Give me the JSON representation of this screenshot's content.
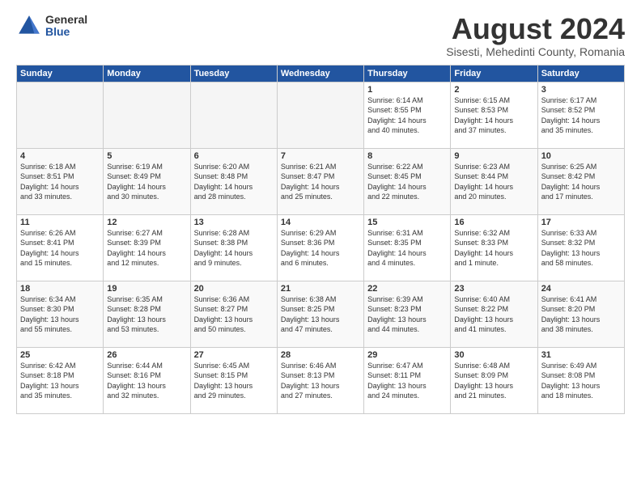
{
  "header": {
    "logo_general": "General",
    "logo_blue": "Blue",
    "main_title": "August 2024",
    "subtitle": "Sisesti, Mehedinti County, Romania"
  },
  "calendar": {
    "headers": [
      "Sunday",
      "Monday",
      "Tuesday",
      "Wednesday",
      "Thursday",
      "Friday",
      "Saturday"
    ],
    "weeks": [
      [
        {
          "day": "",
          "info": ""
        },
        {
          "day": "",
          "info": ""
        },
        {
          "day": "",
          "info": ""
        },
        {
          "day": "",
          "info": ""
        },
        {
          "day": "1",
          "info": "Sunrise: 6:14 AM\nSunset: 8:55 PM\nDaylight: 14 hours\nand 40 minutes."
        },
        {
          "day": "2",
          "info": "Sunrise: 6:15 AM\nSunset: 8:53 PM\nDaylight: 14 hours\nand 37 minutes."
        },
        {
          "day": "3",
          "info": "Sunrise: 6:17 AM\nSunset: 8:52 PM\nDaylight: 14 hours\nand 35 minutes."
        }
      ],
      [
        {
          "day": "4",
          "info": "Sunrise: 6:18 AM\nSunset: 8:51 PM\nDaylight: 14 hours\nand 33 minutes."
        },
        {
          "day": "5",
          "info": "Sunrise: 6:19 AM\nSunset: 8:49 PM\nDaylight: 14 hours\nand 30 minutes."
        },
        {
          "day": "6",
          "info": "Sunrise: 6:20 AM\nSunset: 8:48 PM\nDaylight: 14 hours\nand 28 minutes."
        },
        {
          "day": "7",
          "info": "Sunrise: 6:21 AM\nSunset: 8:47 PM\nDaylight: 14 hours\nand 25 minutes."
        },
        {
          "day": "8",
          "info": "Sunrise: 6:22 AM\nSunset: 8:45 PM\nDaylight: 14 hours\nand 22 minutes."
        },
        {
          "day": "9",
          "info": "Sunrise: 6:23 AM\nSunset: 8:44 PM\nDaylight: 14 hours\nand 20 minutes."
        },
        {
          "day": "10",
          "info": "Sunrise: 6:25 AM\nSunset: 8:42 PM\nDaylight: 14 hours\nand 17 minutes."
        }
      ],
      [
        {
          "day": "11",
          "info": "Sunrise: 6:26 AM\nSunset: 8:41 PM\nDaylight: 14 hours\nand 15 minutes."
        },
        {
          "day": "12",
          "info": "Sunrise: 6:27 AM\nSunset: 8:39 PM\nDaylight: 14 hours\nand 12 minutes."
        },
        {
          "day": "13",
          "info": "Sunrise: 6:28 AM\nSunset: 8:38 PM\nDaylight: 14 hours\nand 9 minutes."
        },
        {
          "day": "14",
          "info": "Sunrise: 6:29 AM\nSunset: 8:36 PM\nDaylight: 14 hours\nand 6 minutes."
        },
        {
          "day": "15",
          "info": "Sunrise: 6:31 AM\nSunset: 8:35 PM\nDaylight: 14 hours\nand 4 minutes."
        },
        {
          "day": "16",
          "info": "Sunrise: 6:32 AM\nSunset: 8:33 PM\nDaylight: 14 hours\nand 1 minute."
        },
        {
          "day": "17",
          "info": "Sunrise: 6:33 AM\nSunset: 8:32 PM\nDaylight: 13 hours\nand 58 minutes."
        }
      ],
      [
        {
          "day": "18",
          "info": "Sunrise: 6:34 AM\nSunset: 8:30 PM\nDaylight: 13 hours\nand 55 minutes."
        },
        {
          "day": "19",
          "info": "Sunrise: 6:35 AM\nSunset: 8:28 PM\nDaylight: 13 hours\nand 53 minutes."
        },
        {
          "day": "20",
          "info": "Sunrise: 6:36 AM\nSunset: 8:27 PM\nDaylight: 13 hours\nand 50 minutes."
        },
        {
          "day": "21",
          "info": "Sunrise: 6:38 AM\nSunset: 8:25 PM\nDaylight: 13 hours\nand 47 minutes."
        },
        {
          "day": "22",
          "info": "Sunrise: 6:39 AM\nSunset: 8:23 PM\nDaylight: 13 hours\nand 44 minutes."
        },
        {
          "day": "23",
          "info": "Sunrise: 6:40 AM\nSunset: 8:22 PM\nDaylight: 13 hours\nand 41 minutes."
        },
        {
          "day": "24",
          "info": "Sunrise: 6:41 AM\nSunset: 8:20 PM\nDaylight: 13 hours\nand 38 minutes."
        }
      ],
      [
        {
          "day": "25",
          "info": "Sunrise: 6:42 AM\nSunset: 8:18 PM\nDaylight: 13 hours\nand 35 minutes."
        },
        {
          "day": "26",
          "info": "Sunrise: 6:44 AM\nSunset: 8:16 PM\nDaylight: 13 hours\nand 32 minutes."
        },
        {
          "day": "27",
          "info": "Sunrise: 6:45 AM\nSunset: 8:15 PM\nDaylight: 13 hours\nand 29 minutes."
        },
        {
          "day": "28",
          "info": "Sunrise: 6:46 AM\nSunset: 8:13 PM\nDaylight: 13 hours\nand 27 minutes."
        },
        {
          "day": "29",
          "info": "Sunrise: 6:47 AM\nSunset: 8:11 PM\nDaylight: 13 hours\nand 24 minutes."
        },
        {
          "day": "30",
          "info": "Sunrise: 6:48 AM\nSunset: 8:09 PM\nDaylight: 13 hours\nand 21 minutes."
        },
        {
          "day": "31",
          "info": "Sunrise: 6:49 AM\nSunset: 8:08 PM\nDaylight: 13 hours\nand 18 minutes."
        }
      ]
    ]
  }
}
